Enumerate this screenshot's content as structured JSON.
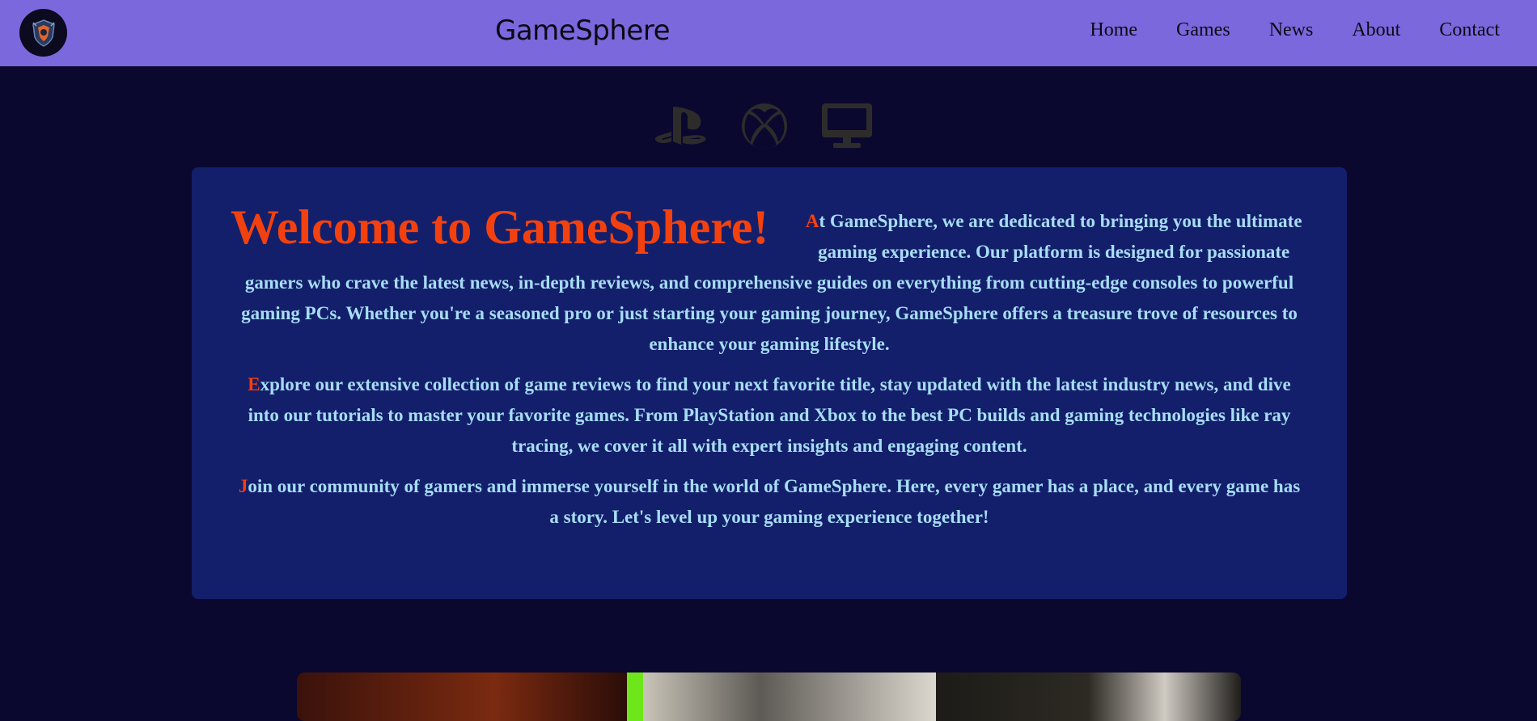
{
  "navbar": {
    "brand": "GameSphere",
    "links": [
      "Home",
      "Games",
      "News",
      "About",
      "Contact"
    ],
    "background": "#7b68dd"
  },
  "platforms": {
    "icons": [
      "playstation-icon",
      "xbox-icon",
      "pc-monitor-icon"
    ]
  },
  "intro": {
    "title": "Welcome to GameSphere!",
    "paragraphs": [
      {
        "initial": "A",
        "text": "t GameSphere, we are dedicated to bringing you the ultimate gaming experience. Our platform is designed for passionate gamers who crave the latest news, in-depth reviews, and comprehensive guides on everything from cutting-edge consoles to powerful gaming PCs. Whether you're a seasoned pro or just starting your gaming journey, GameSphere offers a treasure trove of resources to enhance your gaming lifestyle."
      },
      {
        "initial": "E",
        "text": "xplore our extensive collection of game reviews to find your next favorite title, stay updated with the latest industry news, and dive into our tutorials to master your favorite games. From PlayStation and Xbox to the best PC builds and gaming technologies like ray tracing, we cover it all with expert insights and engaging content."
      },
      {
        "initial": "J",
        "text": "oin our community of gamers and immerse yourself in the world of GameSphere. Here, every gamer has a place, and every game has a story. Let's level up your gaming experience together!"
      }
    ]
  },
  "colors": {
    "page_background": "#0b0830",
    "card_background": "#141f6b",
    "accent": "#f2410f",
    "body_text": "#a6ddf4"
  }
}
